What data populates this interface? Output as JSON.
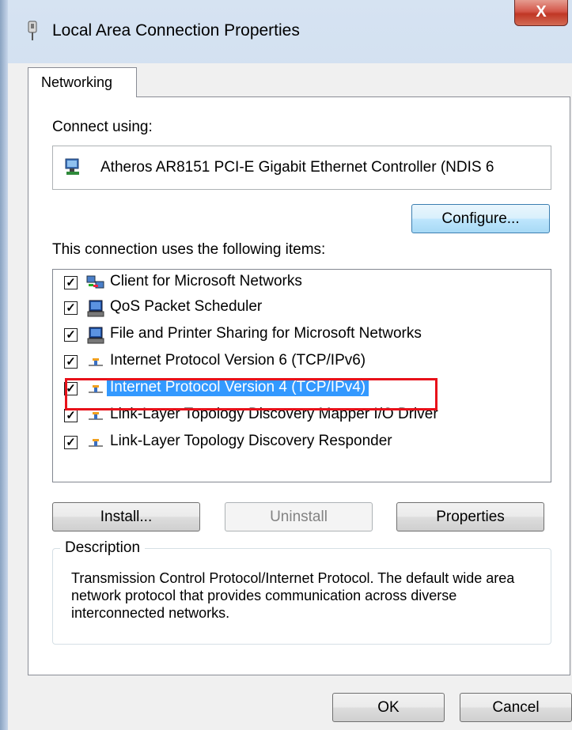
{
  "window": {
    "title": "Local Area Connection Properties",
    "close_label": "X"
  },
  "tabs": [
    {
      "label": "Networking",
      "selected": true
    }
  ],
  "connect_using": {
    "label": "Connect using:",
    "adapter": "Atheros AR8151 PCI-E Gigabit Ethernet Controller (NDIS 6",
    "configure_button": "Configure..."
  },
  "items_section": {
    "label": "This connection uses the following items:",
    "items": [
      {
        "label": "Client for Microsoft Networks",
        "checked": true,
        "icon": "network-client-icon"
      },
      {
        "label": "QoS Packet Scheduler",
        "checked": true,
        "icon": "service-icon"
      },
      {
        "label": "File and Printer Sharing for Microsoft Networks",
        "checked": true,
        "icon": "service-icon"
      },
      {
        "label": "Internet Protocol Version 6 (TCP/IPv6)",
        "checked": true,
        "icon": "protocol-icon"
      },
      {
        "label": "Internet Protocol Version 4 (TCP/IPv4)",
        "checked": true,
        "icon": "protocol-icon",
        "selected": true
      },
      {
        "label": "Link-Layer Topology Discovery Mapper I/O Driver",
        "checked": true,
        "icon": "protocol-icon"
      },
      {
        "label": "Link-Layer Topology Discovery Responder",
        "checked": true,
        "icon": "protocol-icon"
      }
    ]
  },
  "buttons": {
    "install": "Install...",
    "uninstall": "Uninstall",
    "properties": "Properties",
    "ok": "OK",
    "cancel": "Cancel"
  },
  "description": {
    "legend": "Description",
    "text": "Transmission Control Protocol/Internet Protocol. The default wide area network protocol that provides communication across diverse interconnected networks."
  },
  "colors": {
    "selection": "#3399ff",
    "annotation": "#e8111a"
  }
}
